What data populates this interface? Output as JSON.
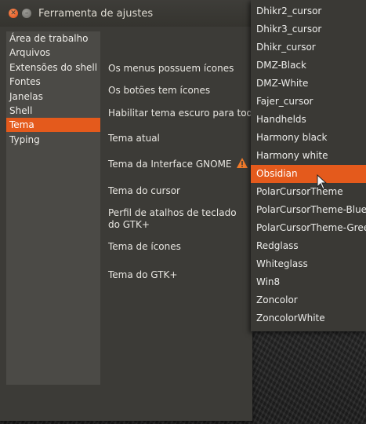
{
  "window": {
    "title": "Ferramenta de ajustes"
  },
  "sidebar": {
    "items": [
      {
        "label": "Área de trabalho"
      },
      {
        "label": "Arquivos"
      },
      {
        "label": "Extensões do shell"
      },
      {
        "label": "Fontes"
      },
      {
        "label": "Janelas"
      },
      {
        "label": "Shell"
      },
      {
        "label": "Tema",
        "selected": true
      },
      {
        "label": "Typing"
      }
    ]
  },
  "options": [
    {
      "label": "Os menus possuem ícones"
    },
    {
      "label": "Os botões tem ícones"
    },
    {
      "label": "Habilitar tema escuro para todos a"
    },
    {
      "label": "Tema atual"
    },
    {
      "label": "Tema da Interface GNOME",
      "warning_icon": "warning-icon"
    },
    {
      "label": "Tema do cursor"
    },
    {
      "label": "Perfil de atalhos de teclado do GTK+"
    },
    {
      "label": "Tema de ícones"
    },
    {
      "label": "Tema do GTK+"
    }
  ],
  "cursor_menu": {
    "items": [
      {
        "label": "Dhikr2_cursor"
      },
      {
        "label": "Dhikr3_cursor"
      },
      {
        "label": "Dhikr_cursor"
      },
      {
        "label": "DMZ-Black"
      },
      {
        "label": "DMZ-White"
      },
      {
        "label": "Fajer_cursor"
      },
      {
        "label": "Handhelds"
      },
      {
        "label": "Harmony black"
      },
      {
        "label": "Harmony white"
      },
      {
        "label": "Obsidian",
        "selected": true
      },
      {
        "label": "PolarCursorTheme"
      },
      {
        "label": "PolarCursorTheme-Blue"
      },
      {
        "label": "PolarCursorTheme-Green"
      },
      {
        "label": "Redglass"
      },
      {
        "label": "Whiteglass"
      },
      {
        "label": "Win8"
      },
      {
        "label": "Zoncolor"
      },
      {
        "label": "ZoncolorWhite"
      }
    ]
  },
  "colors": {
    "accent": "#e45a1c",
    "window_bg": "#3c3b37",
    "sidebar_bg": "#4b4a46"
  }
}
